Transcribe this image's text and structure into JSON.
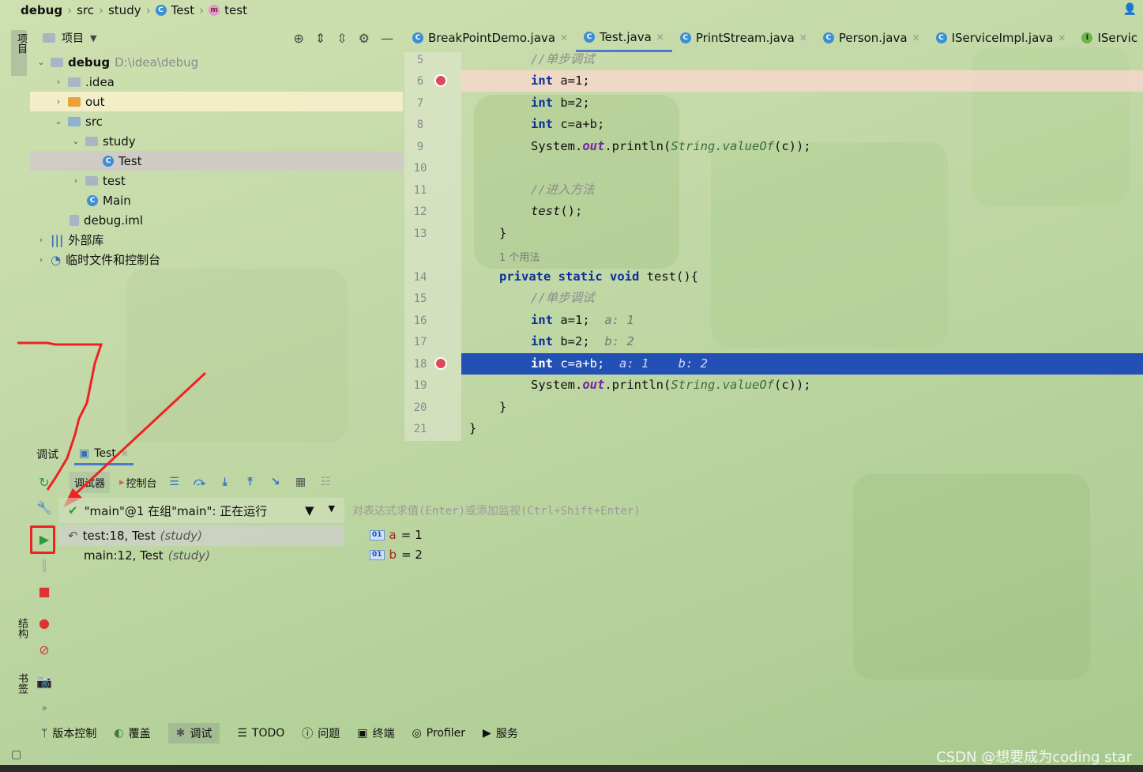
{
  "breadcrumb": {
    "project": "debug",
    "src": "src",
    "pkg": "study",
    "cls": "Test",
    "method": "test"
  },
  "left_strip": {
    "project": "项目",
    "structure": "结构",
    "bookmarks": "书签"
  },
  "project_panel": {
    "title": "项目",
    "root": {
      "name": "debug",
      "path": "D:\\idea\\debug"
    },
    "items": [
      {
        "name": ".idea"
      },
      {
        "name": "out"
      },
      {
        "name": "src"
      },
      {
        "name": "study"
      },
      {
        "name": "Test"
      },
      {
        "name": "test"
      },
      {
        "name": "Main"
      },
      {
        "name": "debug.iml"
      },
      {
        "name": "外部库"
      },
      {
        "name": "临时文件和控制台"
      }
    ]
  },
  "editor_tabs": [
    {
      "label": "BreakPointDemo.java"
    },
    {
      "label": "Test.java"
    },
    {
      "label": "PrintStream.java"
    },
    {
      "label": "Person.java"
    },
    {
      "label": "IServiceImpl.java"
    },
    {
      "label": "IServic"
    }
  ],
  "editor": {
    "line_numbers": [
      "5",
      "6",
      "7",
      "8",
      "9",
      "10",
      "11",
      "12",
      "13",
      "14",
      "15",
      "16",
      "17",
      "18",
      "19",
      "20",
      "21"
    ],
    "usage_hint": "1 个用法",
    "c_step": "//单步调试",
    "c_enter": "//进入方法",
    "kw_int": "int",
    "kw_private": "private",
    "kw_static": "static",
    "kw_void": "void",
    "a_assign": "a=1;",
    "b_assign": "b=2;",
    "c_assign": "c=a+b;",
    "sys": "System.",
    "out": "out",
    "println": ".println(",
    "string": "String.",
    "valueof": "valueOf",
    "tail": "(c));",
    "test_call": "test",
    "test_call_tail": "();",
    "brace_close": "}",
    "test_decl": "test(){",
    "hint_a": "a: 1",
    "hint_b": "b: 2"
  },
  "debug_panel": {
    "tab_debug": "调试",
    "tab_session": "Test",
    "debugger_tab": "调试器",
    "console_tab": "控制台",
    "thread": "\"main\"@1 在组\"main\": 正在运行",
    "frames": [
      {
        "loc": "test:18, Test",
        "pkg": "(study)"
      },
      {
        "loc": "main:12, Test",
        "pkg": "(study)"
      }
    ],
    "watch_placeholder": "对表达式求值(Enter)或添加监视(Ctrl+Shift+Enter)",
    "variables": [
      {
        "name": "a",
        "value": "= 1"
      },
      {
        "name": "b",
        "value": "= 2"
      }
    ]
  },
  "bottom_bar": [
    {
      "label": "版本控制"
    },
    {
      "label": "覆盖"
    },
    {
      "label": "调试"
    },
    {
      "label": "TODO"
    },
    {
      "label": "问题"
    },
    {
      "label": "终端"
    },
    {
      "label": "Profiler"
    },
    {
      "label": "服务"
    }
  ],
  "watermark": "CSDN @想要成为coding star",
  "colors": {
    "execution_line": "#2350b4",
    "breakpoint": "#db4a5a",
    "annotation_red": "#e22222"
  }
}
